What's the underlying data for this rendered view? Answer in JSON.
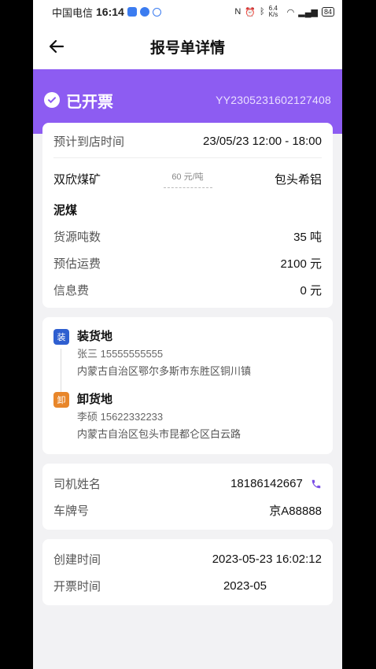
{
  "statusbar": {
    "carrier": "中国电信",
    "time": "16:14",
    "net_speed": "6.4 K/s",
    "battery": "84"
  },
  "nav": {
    "title": "报号单详情"
  },
  "banner": {
    "status": "已开票",
    "order_no": "YY2305231602127408",
    "color": "#8d5cf2"
  },
  "trip": {
    "arrival_label": "预计到店时间",
    "arrival_value": "23/05/23 12:00 - 18:00",
    "origin": "双欣煤矿",
    "price": "60 元/吨",
    "destination": "包头希铝",
    "goods": "泥煤",
    "tonnage_label": "货源吨数",
    "tonnage_value": "35 吨",
    "freight_label": "预估运费",
    "freight_value": "2100 元",
    "fee_label": "信息费",
    "fee_value": "0 元"
  },
  "loading": {
    "badge": "装",
    "title": "装货地",
    "person": "张三 15555555555",
    "address": "内蒙古自治区鄂尔多斯市东胜区铜川镇",
    "color": "#2f5fd0"
  },
  "unloading": {
    "badge": "卸",
    "title": "卸货地",
    "person": "李硕 15622332233",
    "address": "内蒙古自治区包头市昆都仑区白云路",
    "color": "#e8862a"
  },
  "driver": {
    "name_label": "司机姓名",
    "name_value": "18186142667",
    "plate_label": "车牌号",
    "plate_value": "京A88888"
  },
  "times": {
    "created_label": "创建时间",
    "created_value": "2023-05-23 16:02:12",
    "invoiced_label": "开票时间",
    "invoiced_value": "2023-05"
  }
}
